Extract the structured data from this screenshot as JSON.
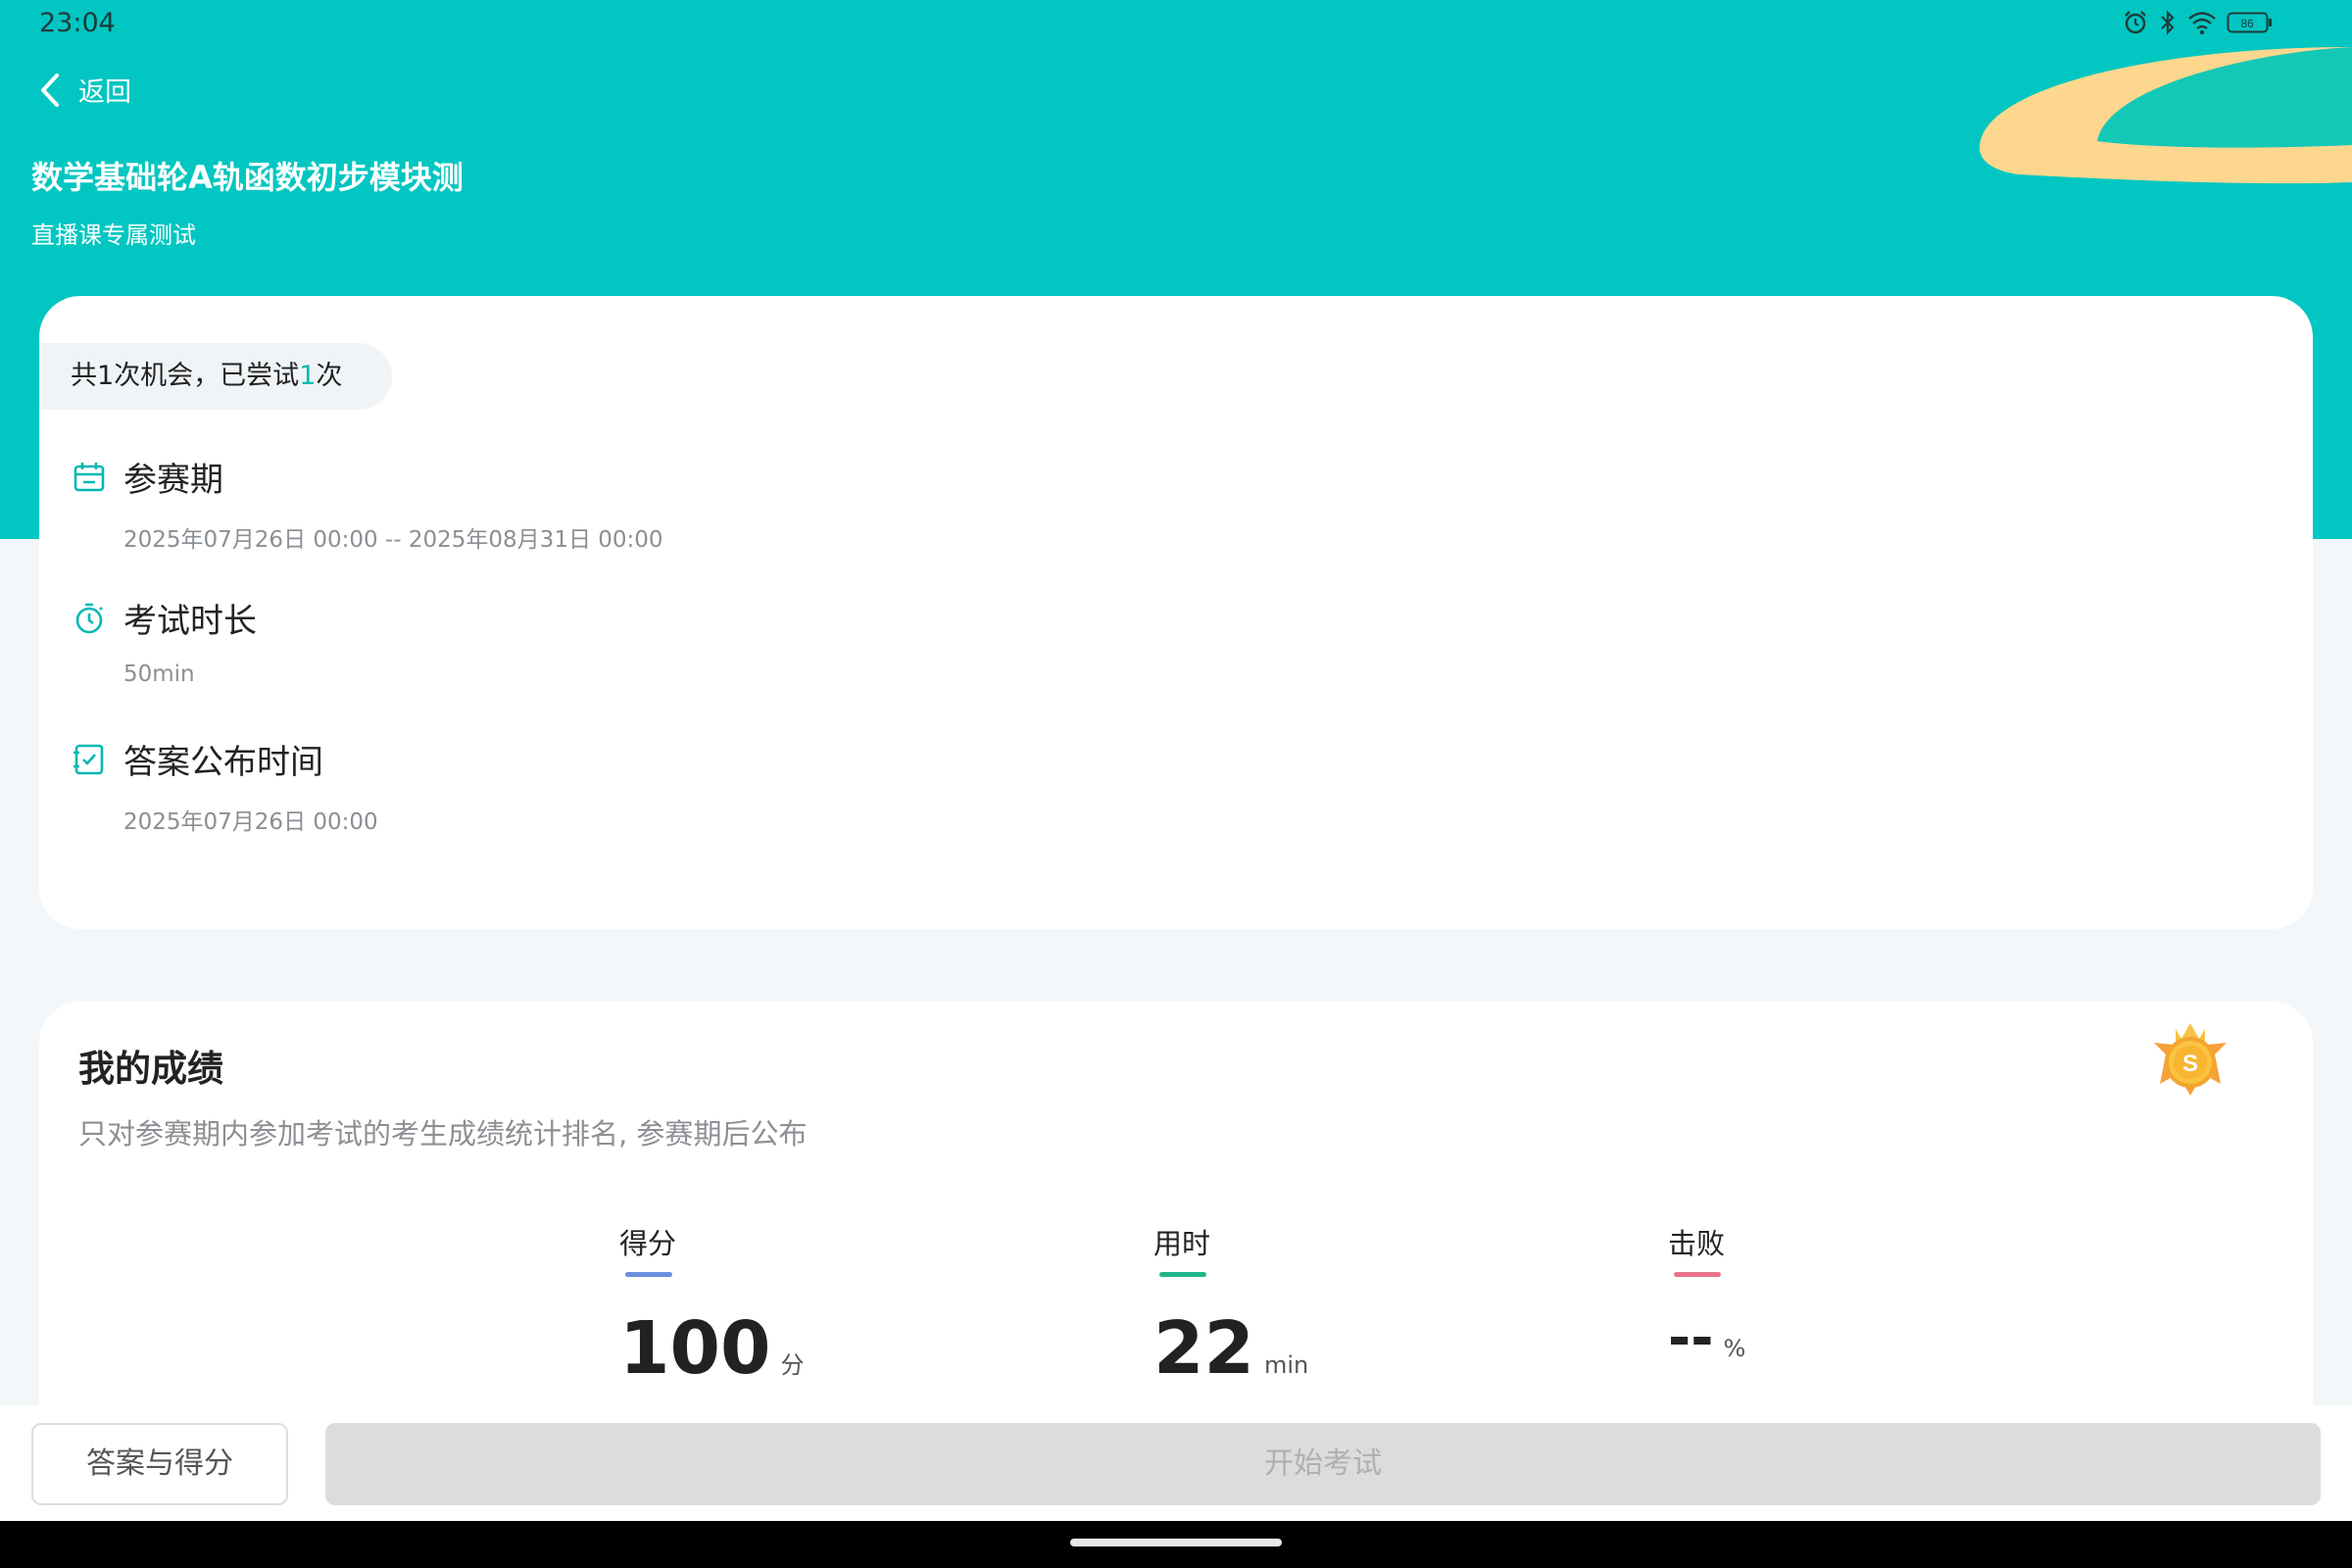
{
  "status_bar": {
    "time": "23:04",
    "battery": "86",
    "icons": [
      "alarm-icon",
      "bluetooth-icon",
      "wifi-icon",
      "battery-icon"
    ]
  },
  "header": {
    "back_label": "返回",
    "title": "数学基础轮A轨函数初步模块测",
    "subtitle": "直播课专属测试"
  },
  "info": {
    "chance_prefix": "共1次机会，已尝试",
    "chance_count": "1",
    "chance_suffix": "次",
    "items": [
      {
        "icon": "calendar-icon",
        "title": "参赛期",
        "value": "2025年07月26日 00:00  --  2025年08月31日 00:00"
      },
      {
        "icon": "stopwatch-icon",
        "title": "考试时长",
        "value": "50min"
      },
      {
        "icon": "checklist-icon",
        "title": "答案公布时间",
        "value": "2025年07月26日 00:00"
      }
    ]
  },
  "score": {
    "title": "我的成绩",
    "description": "只对参赛期内参加考试的考生成绩统计排名, 参赛期后公布",
    "medal_letter": "S",
    "stats": [
      {
        "label": "得分",
        "value": "100",
        "unit": "分",
        "color": "#6a8fe0"
      },
      {
        "label": "用时",
        "value": "22",
        "unit": "min",
        "color": "#1fb58a"
      },
      {
        "label": "击败",
        "value": "--",
        "unit": "%",
        "color": "#e8738c"
      }
    ]
  },
  "actions": {
    "answers_label": "答案与得分",
    "start_label": "开始考试"
  },
  "colors": {
    "accent": "#02c6c1",
    "card_bg": "#ffffff",
    "page_bg": "#f4f7f9",
    "deco_sand": "#fdd78e",
    "deco_teal": "#14c8b8"
  }
}
